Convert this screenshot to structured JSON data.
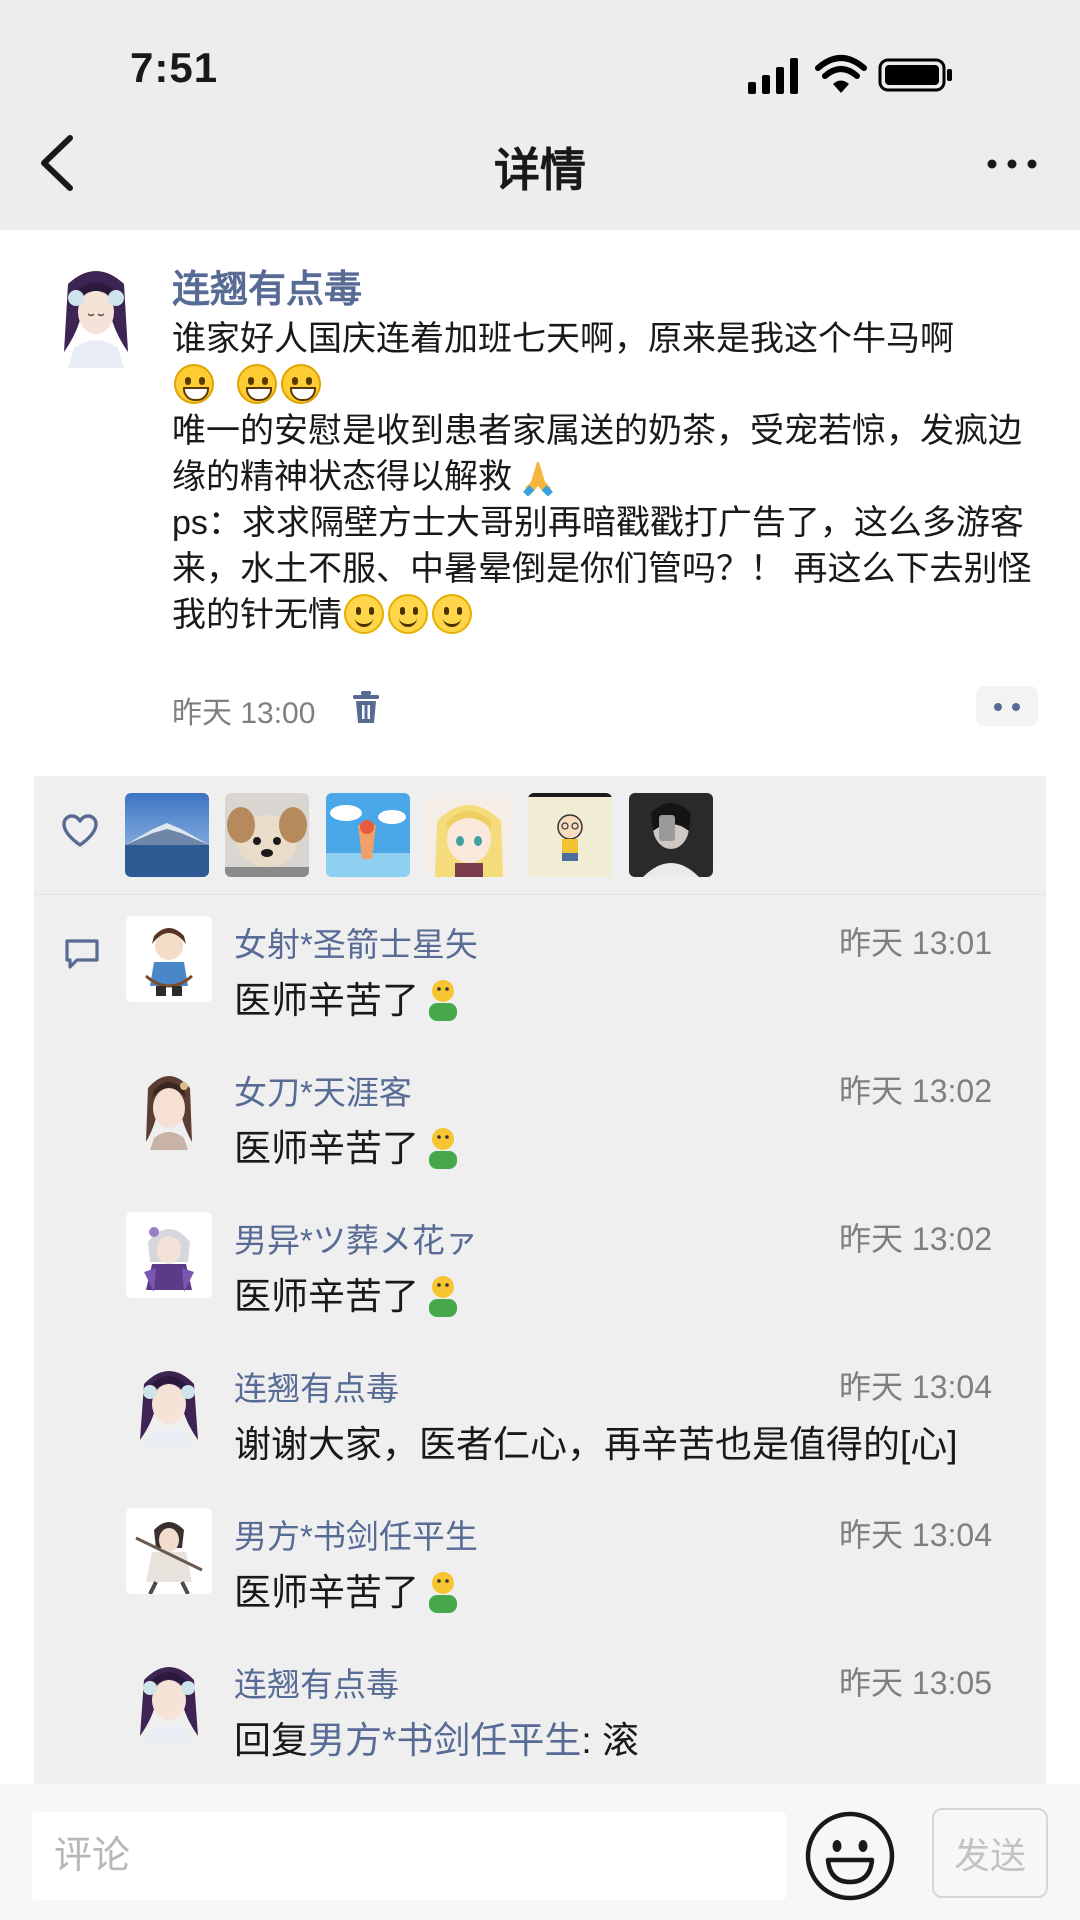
{
  "status_bar": {
    "time": "7:51"
  },
  "nav": {
    "title": "详情",
    "back_icon": "chevron-left-icon",
    "more_icon": "ellipsis-icon"
  },
  "post": {
    "author": "连翘有点毒",
    "lines": [
      "谁家好人国庆连着加班七天啊，原来是我这个牛马啊",
      "唯一的安慰是收到患者家属送的奶茶，受宠若惊，发疯边缘的精神状态得以解救",
      "ps：求求隔壁方士大哥别再暗戳戳打广告了，这么多游客来，水土不服、中暑晕倒是你们管吗？！ 再这么下去别怪我的针无情"
    ],
    "time": "昨天 13:00"
  },
  "likes": {
    "icon": "heart-icon",
    "avatars": [
      "mountain-lake-avatar",
      "puppy-avatar",
      "beach-drink-avatar",
      "anime-girl-avatar",
      "cartoon-boy-avatar",
      "mirror-selfie-avatar"
    ]
  },
  "comments_icon": "comment-bubble-icon",
  "comments": [
    {
      "name": "女射*圣箭士星矢",
      "time": "昨天 13:01",
      "text": "医师辛苦了"
    },
    {
      "name": "女刀*天涯客",
      "time": "昨天 13:02",
      "text": "医师辛苦了"
    },
    {
      "name": "男异*ツ葬メ花ァ",
      "time": "昨天 13:02",
      "text": "医师辛苦了"
    },
    {
      "name": "连翘有点毒",
      "time": "昨天 13:04",
      "text": "谢谢大家，医者仁心，再辛苦也是值得的[心]"
    },
    {
      "name": "男方*书剑任平生",
      "time": "昨天 13:04",
      "text": "医师辛苦了"
    },
    {
      "name": "连翘有点毒",
      "time": "昨天 13:05",
      "reply_prefix": "回复",
      "reply_to": "男方*书剑任平生",
      "reply_text": ": 滚"
    }
  ],
  "input": {
    "placeholder": "评论",
    "send_label": "发送"
  },
  "colors": {
    "link": "#576b95",
    "header_bg": "#ededed",
    "panel_bg": "#efefef"
  }
}
